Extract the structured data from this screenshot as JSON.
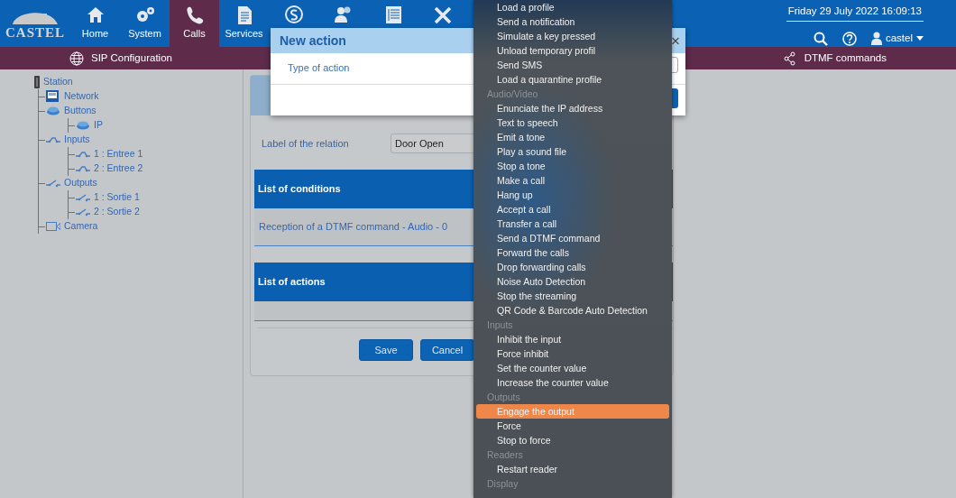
{
  "header": {
    "logo": "CASTEL",
    "nav": [
      {
        "label": "Home",
        "selected": false
      },
      {
        "label": "System",
        "selected": false
      },
      {
        "label": "Calls",
        "selected": true
      },
      {
        "label": "Services",
        "selected": false
      },
      {
        "selected": false
      },
      {
        "selected": false
      },
      {
        "selected": false
      },
      {
        "selected": false
      }
    ],
    "datetime": "Friday 29 July 2022 16:09:13",
    "user": "castel"
  },
  "subnav": [
    {
      "label": "SIP Configuration"
    },
    {
      "label": "DTMF commands"
    }
  ],
  "tree": [
    {
      "label": "Station",
      "kind": "station",
      "children": [
        {
          "label": "Network",
          "kind": "network"
        },
        {
          "label": "Buttons",
          "kind": "button",
          "children": [
            {
              "label": "IP",
              "kind": "button"
            }
          ]
        },
        {
          "label": "Inputs",
          "kind": "input",
          "children": [
            {
              "label": "1 : Entree 1",
              "kind": "input"
            },
            {
              "label": "2 : Entree 2",
              "kind": "input"
            }
          ]
        },
        {
          "label": "Outputs",
          "kind": "output",
          "children": [
            {
              "label": "1 : Sortie 1",
              "kind": "output"
            },
            {
              "label": "2 : Sortie 2",
              "kind": "output"
            }
          ]
        },
        {
          "label": "Camera",
          "kind": "camera"
        }
      ]
    }
  ],
  "form": {
    "label": "Label of the relation",
    "value": "Door Open",
    "conditions_title": "List of conditions",
    "conditions": [
      "Reception of a DTMF command - Audio - 0"
    ],
    "actions_title": "List of actions",
    "buttons": [
      "Save",
      "Cancel"
    ]
  },
  "modal": {
    "title": "New action",
    "close": "×",
    "field_label": "Type of action"
  },
  "dropdown": {
    "groups": [
      {
        "items": [
          {
            "label": "Load a profile",
            "selected": false
          },
          {
            "label": "Send a notification",
            "selected": false
          },
          {
            "label": "Simulate a key pressed",
            "selected": false
          },
          {
            "label": "Unload temporary profil",
            "selected": false
          },
          {
            "label": "Send SMS",
            "selected": false
          },
          {
            "label": "Load a quarantine profile",
            "selected": false
          }
        ]
      },
      {
        "label": "Audio/Video",
        "items": [
          {
            "label": "Enunciate the IP address",
            "selected": false
          },
          {
            "label": "Text to speech",
            "selected": false
          },
          {
            "label": "Emit a tone",
            "selected": false
          },
          {
            "label": "Play a sound file",
            "selected": false
          },
          {
            "label": "Stop a tone",
            "selected": false
          },
          {
            "label": "Make a call",
            "selected": false
          },
          {
            "label": "Hang up",
            "selected": false
          },
          {
            "label": "Accept a call",
            "selected": false
          },
          {
            "label": "Transfer a call",
            "selected": false
          },
          {
            "label": "Send a DTMF command",
            "selected": false
          },
          {
            "label": "Forward the calls",
            "selected": false
          },
          {
            "label": "Drop forwarding calls",
            "selected": false
          },
          {
            "label": "Noise Auto Detection",
            "selected": false
          },
          {
            "label": "Stop the streaming",
            "selected": false
          },
          {
            "label": "QR Code & Barcode Auto Detection",
            "selected": false
          }
        ]
      },
      {
        "label": "Inputs",
        "items": [
          {
            "label": "Inhibit the input",
            "selected": false
          },
          {
            "label": "Force inhibit",
            "selected": false
          },
          {
            "label": "Set the counter value",
            "selected": false
          },
          {
            "label": "Increase the counter value",
            "selected": false
          }
        ]
      },
      {
        "label": "Outputs",
        "items": [
          {
            "label": "Engage the output",
            "selected": true
          },
          {
            "label": "Force",
            "selected": false
          },
          {
            "label": "Stop to force",
            "selected": false
          }
        ]
      },
      {
        "label": "Readers",
        "items": [
          {
            "label": "Restart reader",
            "selected": false
          }
        ]
      },
      {
        "label": "Display"
      }
    ]
  }
}
